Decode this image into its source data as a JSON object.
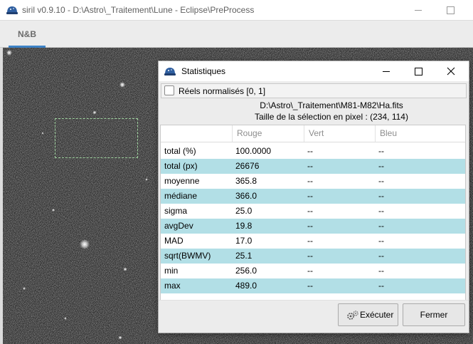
{
  "window": {
    "title": "siril v0.9.10 - D:\\Astro\\_Traitement\\Lune - Eclipse\\PreProcess"
  },
  "tabs": [
    {
      "label": "N&B",
      "active": true
    }
  ],
  "dialog": {
    "title": "Statistiques",
    "normalize_label": "Réels normalisés [0, 1]",
    "normalize_checked": false,
    "file_path": "D:\\Astro\\_Traitement\\M81-M82\\Ha.fits",
    "selection_size": "Taille de la sélection en pixel : (234, 114)",
    "columns": [
      "",
      "Rouge",
      "Vert",
      "Bleu"
    ],
    "rows": [
      [
        "total (%)",
        "100.0000",
        "--",
        "--"
      ],
      [
        "total (px)",
        "26676",
        "--",
        "--"
      ],
      [
        "moyenne",
        "365.8",
        "--",
        "--"
      ],
      [
        "médiane",
        "366.0",
        "--",
        "--"
      ],
      [
        "sigma",
        "25.0",
        "--",
        "--"
      ],
      [
        "avgDev",
        "19.8",
        "--",
        "--"
      ],
      [
        "MAD",
        "17.0",
        "--",
        "--"
      ],
      [
        "sqrt(BWMV)",
        "25.1",
        "--",
        "--"
      ],
      [
        "min",
        "256.0",
        "--",
        "--"
      ],
      [
        "max",
        "489.0",
        "--",
        "--"
      ]
    ],
    "buttons": {
      "run": "Exécuter",
      "close": "Fermer"
    }
  },
  "colors": {
    "row_highlight": "#b2dfe6",
    "tab_accent": "#3d82c6",
    "selection_outline": "#9fd39f"
  },
  "icons": {
    "app": "siril-logo-icon",
    "run": "gears-icon"
  }
}
